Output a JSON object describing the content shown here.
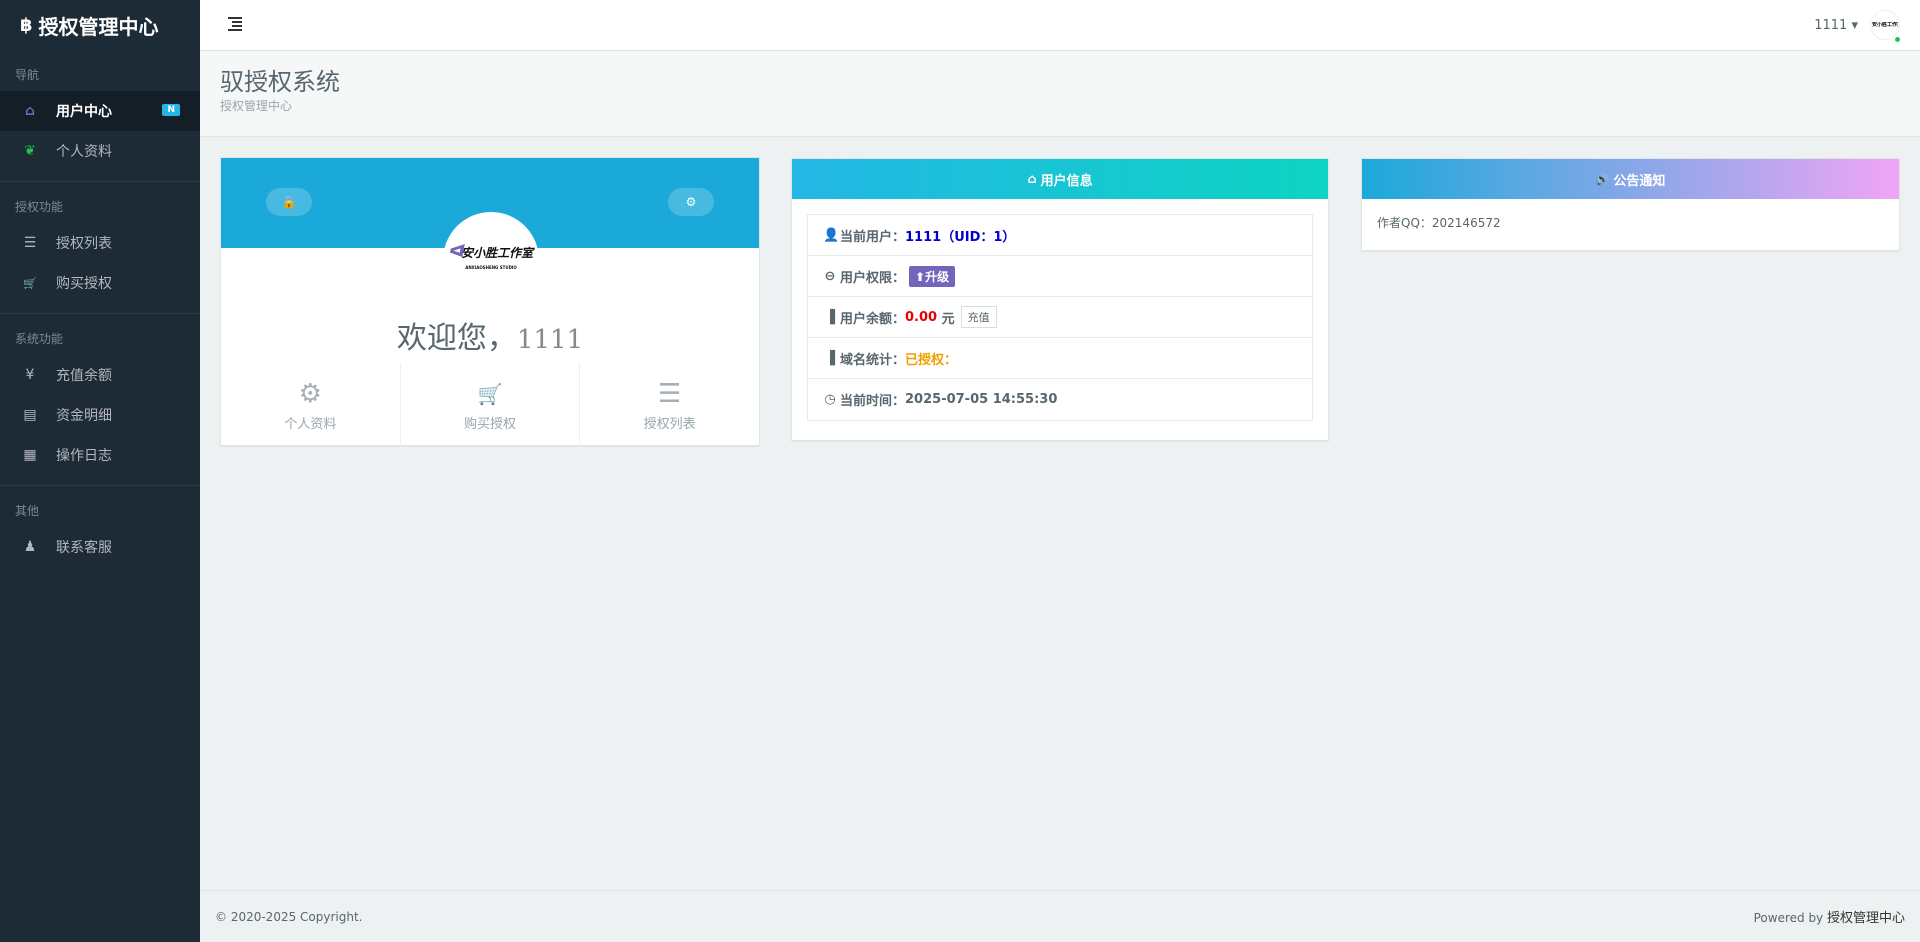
{
  "brand": {
    "icon": "฿",
    "title": "授权管理中心"
  },
  "sidebar": {
    "sections": [
      {
        "title": "导航",
        "items": [
          {
            "label": "用户中心",
            "icon": "home-icon",
            "glyph": "⌂",
            "active": true,
            "badge": "N"
          },
          {
            "label": "个人资料",
            "icon": "leaf-icon",
            "glyph": "❦"
          }
        ]
      },
      {
        "title": "授权功能",
        "items": [
          {
            "label": "授权列表",
            "icon": "list-icon",
            "glyph": "☰"
          },
          {
            "label": "购买授权",
            "icon": "cart-icon",
            "glyph": "🛒"
          }
        ]
      },
      {
        "title": "系统功能",
        "items": [
          {
            "label": "充值余额",
            "icon": "yen-icon",
            "glyph": "¥"
          },
          {
            "label": "资金明细",
            "icon": "ledger-icon",
            "glyph": "▤"
          },
          {
            "label": "操作日志",
            "icon": "calendar-icon",
            "glyph": "▦"
          }
        ]
      },
      {
        "title": "其他",
        "items": [
          {
            "label": "联系客服",
            "icon": "qq-icon",
            "glyph": "♟"
          }
        ]
      }
    ]
  },
  "header": {
    "username": "1111",
    "caret": "▾",
    "avatar_text": "安小胜工作室"
  },
  "page": {
    "title": "驭授权系统",
    "subtitle": "授权管理中心"
  },
  "profile": {
    "welcome": "欢迎您，",
    "username": "1111",
    "logo_text": "安小胜工作室",
    "logo_sub": "ANXIAOSHENG STUDIO",
    "quick": [
      {
        "label": "个人资料",
        "icon": "gear-icon",
        "glyph": "⚙"
      },
      {
        "label": "购买授权",
        "icon": "cart-icon",
        "glyph": "🛒"
      },
      {
        "label": "授权列表",
        "icon": "list-icon",
        "glyph": "☰"
      }
    ]
  },
  "info": {
    "title": "用户信息",
    "title_icon": "⌂",
    "current_user_label": "当前用户：",
    "current_user_value": "1111（UID：1）",
    "permission_label": "用户权限：",
    "upgrade_label": "升级",
    "balance_label": "用户余额：",
    "balance_value": "0.00",
    "balance_unit": "元",
    "recharge_label": "充值",
    "domain_label": "域名统计：",
    "domain_value": "已授权：",
    "time_label": "当前时间：",
    "time_value": "2025-07-05 14:55:30"
  },
  "notice": {
    "title": "公告通知",
    "title_icon": "🔊",
    "body": "作者QQ：202146572"
  },
  "footer": {
    "copyright": "© 2020-2025 Copyright.",
    "powered_prefix": "Powered by ",
    "powered_name": "授权管理中心"
  },
  "colors": {
    "sidebar_bg": "#1c2b36",
    "accent_blue": "#1ba9da",
    "purple": "#7266ba",
    "badge": "#23b7e5"
  }
}
